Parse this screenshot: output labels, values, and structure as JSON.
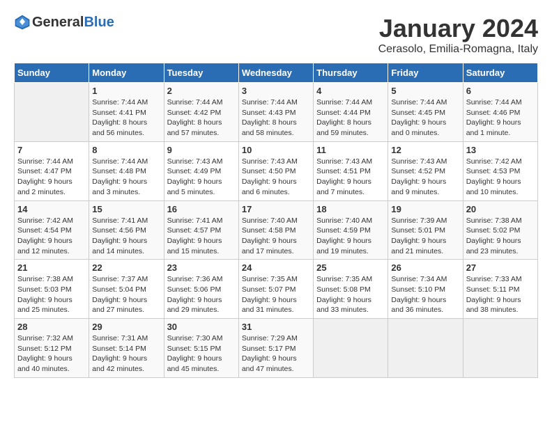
{
  "header": {
    "logo": {
      "general": "General",
      "blue": "Blue"
    },
    "title": "January 2024",
    "location": "Cerasolo, Emilia-Romagna, Italy"
  },
  "calendar": {
    "weekdays": [
      "Sunday",
      "Monday",
      "Tuesday",
      "Wednesday",
      "Thursday",
      "Friday",
      "Saturday"
    ],
    "weeks": [
      [
        {
          "day": "",
          "info": ""
        },
        {
          "day": "1",
          "info": "Sunrise: 7:44 AM\nSunset: 4:41 PM\nDaylight: 8 hours\nand 56 minutes."
        },
        {
          "day": "2",
          "info": "Sunrise: 7:44 AM\nSunset: 4:42 PM\nDaylight: 8 hours\nand 57 minutes."
        },
        {
          "day": "3",
          "info": "Sunrise: 7:44 AM\nSunset: 4:43 PM\nDaylight: 8 hours\nand 58 minutes."
        },
        {
          "day": "4",
          "info": "Sunrise: 7:44 AM\nSunset: 4:44 PM\nDaylight: 8 hours\nand 59 minutes."
        },
        {
          "day": "5",
          "info": "Sunrise: 7:44 AM\nSunset: 4:45 PM\nDaylight: 9 hours\nand 0 minutes."
        },
        {
          "day": "6",
          "info": "Sunrise: 7:44 AM\nSunset: 4:46 PM\nDaylight: 9 hours\nand 1 minute."
        }
      ],
      [
        {
          "day": "7",
          "info": "Sunrise: 7:44 AM\nSunset: 4:47 PM\nDaylight: 9 hours\nand 2 minutes."
        },
        {
          "day": "8",
          "info": "Sunrise: 7:44 AM\nSunset: 4:48 PM\nDaylight: 9 hours\nand 3 minutes."
        },
        {
          "day": "9",
          "info": "Sunrise: 7:43 AM\nSunset: 4:49 PM\nDaylight: 9 hours\nand 5 minutes."
        },
        {
          "day": "10",
          "info": "Sunrise: 7:43 AM\nSunset: 4:50 PM\nDaylight: 9 hours\nand 6 minutes."
        },
        {
          "day": "11",
          "info": "Sunrise: 7:43 AM\nSunset: 4:51 PM\nDaylight: 9 hours\nand 7 minutes."
        },
        {
          "day": "12",
          "info": "Sunrise: 7:43 AM\nSunset: 4:52 PM\nDaylight: 9 hours\nand 9 minutes."
        },
        {
          "day": "13",
          "info": "Sunrise: 7:42 AM\nSunset: 4:53 PM\nDaylight: 9 hours\nand 10 minutes."
        }
      ],
      [
        {
          "day": "14",
          "info": "Sunrise: 7:42 AM\nSunset: 4:54 PM\nDaylight: 9 hours\nand 12 minutes."
        },
        {
          "day": "15",
          "info": "Sunrise: 7:41 AM\nSunset: 4:56 PM\nDaylight: 9 hours\nand 14 minutes."
        },
        {
          "day": "16",
          "info": "Sunrise: 7:41 AM\nSunset: 4:57 PM\nDaylight: 9 hours\nand 15 minutes."
        },
        {
          "day": "17",
          "info": "Sunrise: 7:40 AM\nSunset: 4:58 PM\nDaylight: 9 hours\nand 17 minutes."
        },
        {
          "day": "18",
          "info": "Sunrise: 7:40 AM\nSunset: 4:59 PM\nDaylight: 9 hours\nand 19 minutes."
        },
        {
          "day": "19",
          "info": "Sunrise: 7:39 AM\nSunset: 5:01 PM\nDaylight: 9 hours\nand 21 minutes."
        },
        {
          "day": "20",
          "info": "Sunrise: 7:38 AM\nSunset: 5:02 PM\nDaylight: 9 hours\nand 23 minutes."
        }
      ],
      [
        {
          "day": "21",
          "info": "Sunrise: 7:38 AM\nSunset: 5:03 PM\nDaylight: 9 hours\nand 25 minutes."
        },
        {
          "day": "22",
          "info": "Sunrise: 7:37 AM\nSunset: 5:04 PM\nDaylight: 9 hours\nand 27 minutes."
        },
        {
          "day": "23",
          "info": "Sunrise: 7:36 AM\nSunset: 5:06 PM\nDaylight: 9 hours\nand 29 minutes."
        },
        {
          "day": "24",
          "info": "Sunrise: 7:35 AM\nSunset: 5:07 PM\nDaylight: 9 hours\nand 31 minutes."
        },
        {
          "day": "25",
          "info": "Sunrise: 7:35 AM\nSunset: 5:08 PM\nDaylight: 9 hours\nand 33 minutes."
        },
        {
          "day": "26",
          "info": "Sunrise: 7:34 AM\nSunset: 5:10 PM\nDaylight: 9 hours\nand 36 minutes."
        },
        {
          "day": "27",
          "info": "Sunrise: 7:33 AM\nSunset: 5:11 PM\nDaylight: 9 hours\nand 38 minutes."
        }
      ],
      [
        {
          "day": "28",
          "info": "Sunrise: 7:32 AM\nSunset: 5:12 PM\nDaylight: 9 hours\nand 40 minutes."
        },
        {
          "day": "29",
          "info": "Sunrise: 7:31 AM\nSunset: 5:14 PM\nDaylight: 9 hours\nand 42 minutes."
        },
        {
          "day": "30",
          "info": "Sunrise: 7:30 AM\nSunset: 5:15 PM\nDaylight: 9 hours\nand 45 minutes."
        },
        {
          "day": "31",
          "info": "Sunrise: 7:29 AM\nSunset: 5:17 PM\nDaylight: 9 hours\nand 47 minutes."
        },
        {
          "day": "",
          "info": ""
        },
        {
          "day": "",
          "info": ""
        },
        {
          "day": "",
          "info": ""
        }
      ]
    ]
  }
}
